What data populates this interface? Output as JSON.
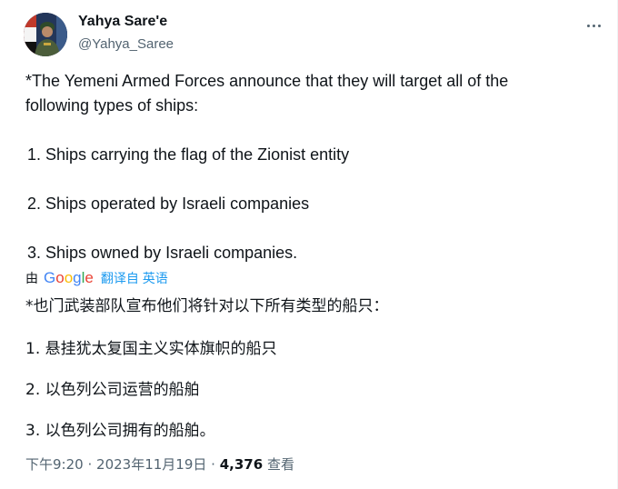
{
  "author": {
    "display_name": "Yahya Sare'e",
    "handle": "@Yahya_Saree"
  },
  "tweet": {
    "intro_line1": "*The Yemeni Armed Forces announce that they will target all of the",
    "intro_line2": "following types of ships:",
    "items": [
      "1.  Ships carrying the flag of the Zionist entity",
      "2.  Ships operated by Israeli companies",
      "3.  Ships owned by Israeli companies."
    ]
  },
  "translation": {
    "by_label": "由",
    "provider": "Google",
    "link_label": "翻译自 英语",
    "intro": "*也门武装部队宣布他们将针对以下所有类型的船只：",
    "items": [
      "1. 悬挂犹太复国主义实体旗帜的船只",
      "2. 以色列公司运营的船舶",
      "3. 以色列公司拥有的船舶。"
    ]
  },
  "meta": {
    "time": "下午9:20",
    "separator": "·",
    "date": "2023年11月19日",
    "views_count": "4,376",
    "views_label": "查看"
  },
  "icons": {
    "more": "more-horizontal-icon",
    "avatar": "avatar-image"
  }
}
